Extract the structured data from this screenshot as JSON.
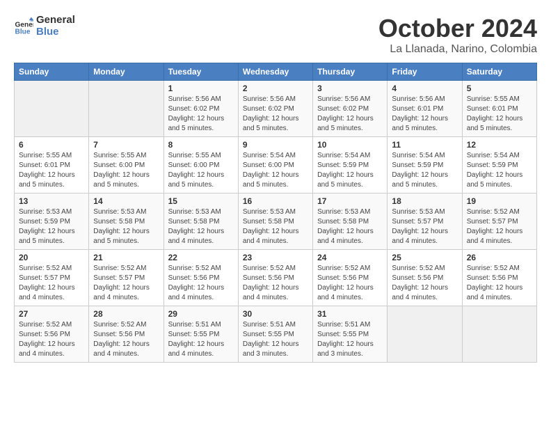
{
  "header": {
    "logo_line1": "General",
    "logo_line2": "Blue",
    "month_title": "October 2024",
    "location": "La Llanada, Narino, Colombia"
  },
  "days_of_week": [
    "Sunday",
    "Monday",
    "Tuesday",
    "Wednesday",
    "Thursday",
    "Friday",
    "Saturday"
  ],
  "weeks": [
    [
      {
        "day": "",
        "info": ""
      },
      {
        "day": "",
        "info": ""
      },
      {
        "day": "1",
        "info": "Sunrise: 5:56 AM\nSunset: 6:02 PM\nDaylight: 12 hours and 5 minutes."
      },
      {
        "day": "2",
        "info": "Sunrise: 5:56 AM\nSunset: 6:02 PM\nDaylight: 12 hours and 5 minutes."
      },
      {
        "day": "3",
        "info": "Sunrise: 5:56 AM\nSunset: 6:02 PM\nDaylight: 12 hours and 5 minutes."
      },
      {
        "day": "4",
        "info": "Sunrise: 5:56 AM\nSunset: 6:01 PM\nDaylight: 12 hours and 5 minutes."
      },
      {
        "day": "5",
        "info": "Sunrise: 5:55 AM\nSunset: 6:01 PM\nDaylight: 12 hours and 5 minutes."
      }
    ],
    [
      {
        "day": "6",
        "info": "Sunrise: 5:55 AM\nSunset: 6:01 PM\nDaylight: 12 hours and 5 minutes."
      },
      {
        "day": "7",
        "info": "Sunrise: 5:55 AM\nSunset: 6:00 PM\nDaylight: 12 hours and 5 minutes."
      },
      {
        "day": "8",
        "info": "Sunrise: 5:55 AM\nSunset: 6:00 PM\nDaylight: 12 hours and 5 minutes."
      },
      {
        "day": "9",
        "info": "Sunrise: 5:54 AM\nSunset: 6:00 PM\nDaylight: 12 hours and 5 minutes."
      },
      {
        "day": "10",
        "info": "Sunrise: 5:54 AM\nSunset: 5:59 PM\nDaylight: 12 hours and 5 minutes."
      },
      {
        "day": "11",
        "info": "Sunrise: 5:54 AM\nSunset: 5:59 PM\nDaylight: 12 hours and 5 minutes."
      },
      {
        "day": "12",
        "info": "Sunrise: 5:54 AM\nSunset: 5:59 PM\nDaylight: 12 hours and 5 minutes."
      }
    ],
    [
      {
        "day": "13",
        "info": "Sunrise: 5:53 AM\nSunset: 5:59 PM\nDaylight: 12 hours and 5 minutes."
      },
      {
        "day": "14",
        "info": "Sunrise: 5:53 AM\nSunset: 5:58 PM\nDaylight: 12 hours and 5 minutes."
      },
      {
        "day": "15",
        "info": "Sunrise: 5:53 AM\nSunset: 5:58 PM\nDaylight: 12 hours and 4 minutes."
      },
      {
        "day": "16",
        "info": "Sunrise: 5:53 AM\nSunset: 5:58 PM\nDaylight: 12 hours and 4 minutes."
      },
      {
        "day": "17",
        "info": "Sunrise: 5:53 AM\nSunset: 5:58 PM\nDaylight: 12 hours and 4 minutes."
      },
      {
        "day": "18",
        "info": "Sunrise: 5:53 AM\nSunset: 5:57 PM\nDaylight: 12 hours and 4 minutes."
      },
      {
        "day": "19",
        "info": "Sunrise: 5:52 AM\nSunset: 5:57 PM\nDaylight: 12 hours and 4 minutes."
      }
    ],
    [
      {
        "day": "20",
        "info": "Sunrise: 5:52 AM\nSunset: 5:57 PM\nDaylight: 12 hours and 4 minutes."
      },
      {
        "day": "21",
        "info": "Sunrise: 5:52 AM\nSunset: 5:57 PM\nDaylight: 12 hours and 4 minutes."
      },
      {
        "day": "22",
        "info": "Sunrise: 5:52 AM\nSunset: 5:56 PM\nDaylight: 12 hours and 4 minutes."
      },
      {
        "day": "23",
        "info": "Sunrise: 5:52 AM\nSunset: 5:56 PM\nDaylight: 12 hours and 4 minutes."
      },
      {
        "day": "24",
        "info": "Sunrise: 5:52 AM\nSunset: 5:56 PM\nDaylight: 12 hours and 4 minutes."
      },
      {
        "day": "25",
        "info": "Sunrise: 5:52 AM\nSunset: 5:56 PM\nDaylight: 12 hours and 4 minutes."
      },
      {
        "day": "26",
        "info": "Sunrise: 5:52 AM\nSunset: 5:56 PM\nDaylight: 12 hours and 4 minutes."
      }
    ],
    [
      {
        "day": "27",
        "info": "Sunrise: 5:52 AM\nSunset: 5:56 PM\nDaylight: 12 hours and 4 minutes."
      },
      {
        "day": "28",
        "info": "Sunrise: 5:52 AM\nSunset: 5:56 PM\nDaylight: 12 hours and 4 minutes."
      },
      {
        "day": "29",
        "info": "Sunrise: 5:51 AM\nSunset: 5:55 PM\nDaylight: 12 hours and 4 minutes."
      },
      {
        "day": "30",
        "info": "Sunrise: 5:51 AM\nSunset: 5:55 PM\nDaylight: 12 hours and 3 minutes."
      },
      {
        "day": "31",
        "info": "Sunrise: 5:51 AM\nSunset: 5:55 PM\nDaylight: 12 hours and 3 minutes."
      },
      {
        "day": "",
        "info": ""
      },
      {
        "day": "",
        "info": ""
      }
    ]
  ]
}
